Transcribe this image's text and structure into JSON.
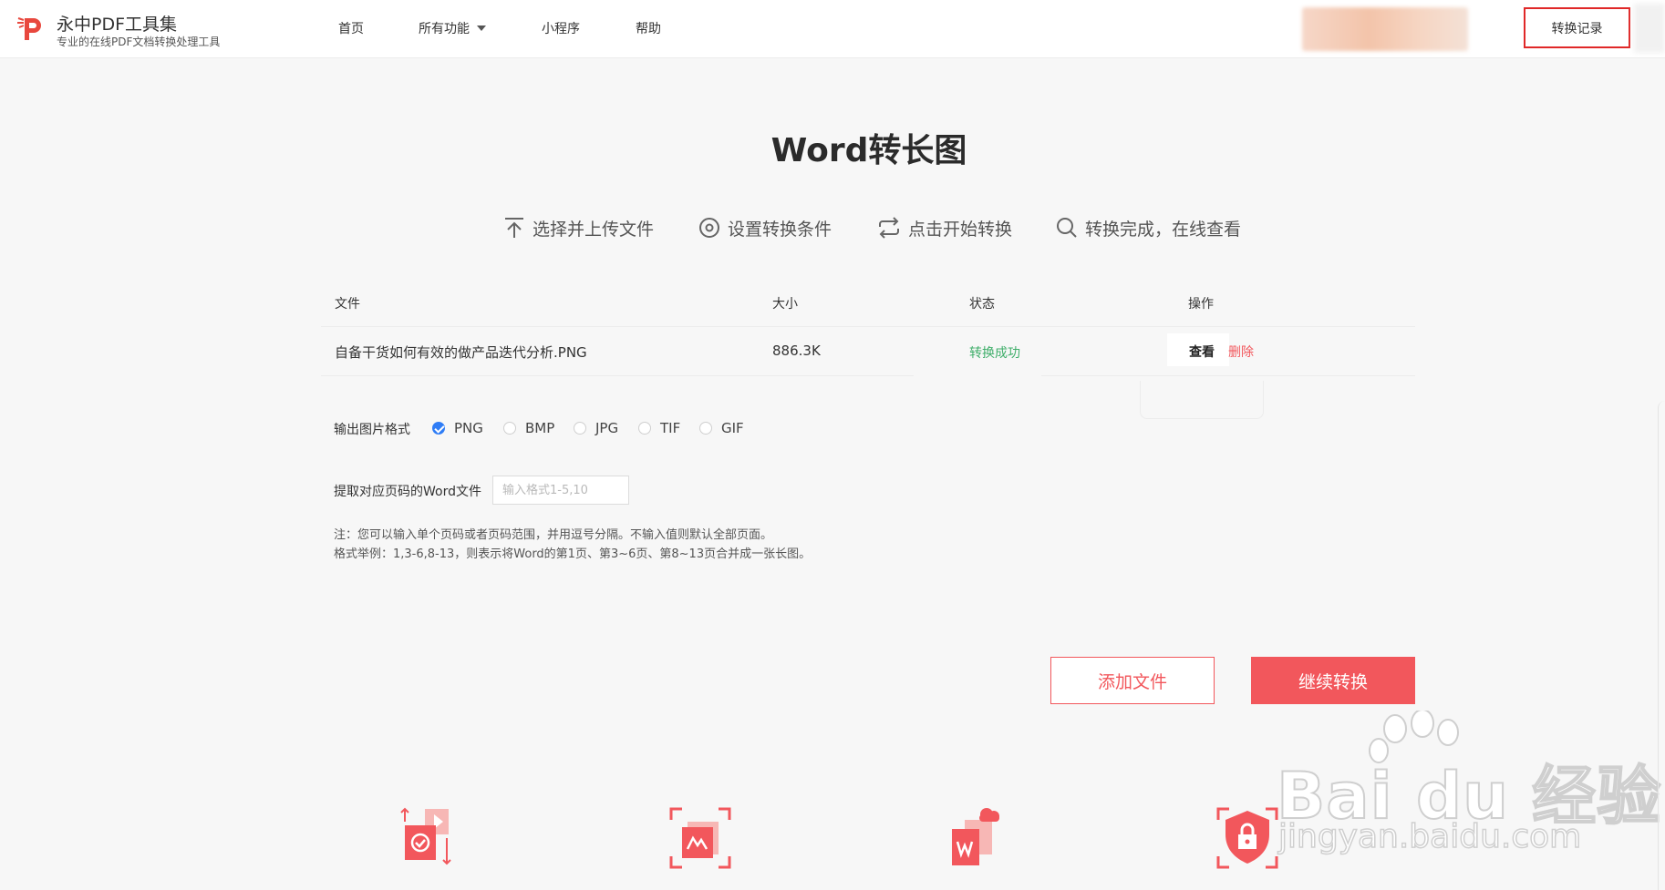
{
  "header": {
    "brand_title": "永中PDF工具集",
    "brand_subtitle": "专业的在线PDF文档转换处理工具",
    "nav": [
      {
        "label": "首页"
      },
      {
        "label": "所有功能"
      },
      {
        "label": "小程序"
      },
      {
        "label": "帮助"
      }
    ],
    "record_button": "转换记录"
  },
  "page_title": "Word转长图",
  "steps": [
    {
      "label": "选择并上传文件",
      "icon": "upload-icon"
    },
    {
      "label": "设置转换条件",
      "icon": "settings-icon"
    },
    {
      "label": "点击开始转换",
      "icon": "refresh-icon"
    },
    {
      "label": "转换完成，在线查看",
      "icon": "search-icon"
    }
  ],
  "table": {
    "headers": {
      "file": "文件",
      "size": "大小",
      "status": "状态",
      "action": "操作"
    },
    "rows": [
      {
        "file": "自备干货如何有效的做产品迭代分析.PNG",
        "size": "886.3K",
        "status": "转换成功",
        "view": "查看",
        "delete": "删除"
      }
    ]
  },
  "format": {
    "label": "输出图片格式",
    "options": [
      "PNG",
      "BMP",
      "JPG",
      "TIF",
      "GIF"
    ],
    "selected": "PNG"
  },
  "pages": {
    "label": "提取对应页码的Word文件",
    "placeholder": "输入格式1-5,10",
    "value": ""
  },
  "notes": [
    "注：您可以输入单个页码或者页码范围，并用逗号分隔。不输入值则默认全部页面。",
    "格式举例：1,3-6,8-13，则表示将Word的第1页、第3~6页、第8~13页合并成一张长图。"
  ],
  "buttons": {
    "add_file": "添加文件",
    "continue": "继续转换"
  },
  "watermark": {
    "text": "Bai du 经验",
    "url": "jingyan.baidu.com"
  },
  "colors": {
    "accent": "#f2575c",
    "success": "#3fae6a",
    "checked": "#2f7df6",
    "highlight_border": "#e02828"
  }
}
